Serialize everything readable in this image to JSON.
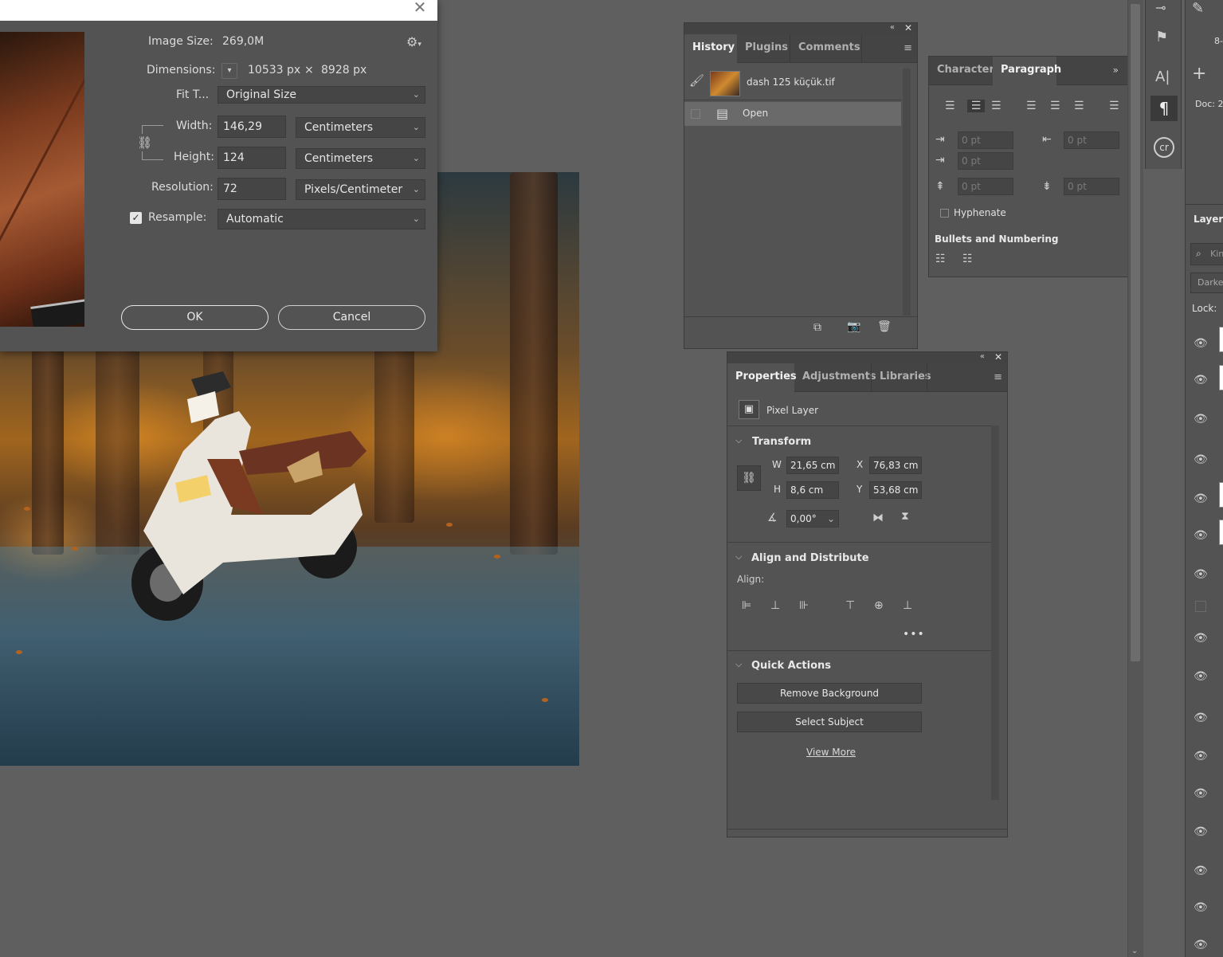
{
  "dialog": {
    "image_size_label": "Image Size:",
    "image_size_value": "269,0M",
    "dimensions_label": "Dimensions:",
    "dimensions_width": "10533 px",
    "dimensions_times": "×",
    "dimensions_height": "8928 px",
    "fit_to_label": "Fit T...",
    "fit_to_value": "Original Size",
    "width_label": "Width:",
    "width_value": "146,29",
    "width_unit": "Centimeters",
    "height_label": "Height:",
    "height_value": "124",
    "height_unit": "Centimeters",
    "resolution_label": "Resolution:",
    "resolution_value": "72",
    "resolution_unit": "Pixels/Centimeter",
    "resample_label": "Resample:",
    "resample_checked": true,
    "resample_value": "Automatic",
    "ok_label": "OK",
    "cancel_label": "Cancel",
    "close_glyph": "✕"
  },
  "history_panel": {
    "tabs": [
      "History",
      "Plugins",
      "Comments"
    ],
    "active_tab": "History",
    "snapshot_name": "dash 125 küçük.tif",
    "items": [
      {
        "label": "Open",
        "selected": true
      }
    ]
  },
  "paragraph_panel": {
    "tabs": [
      "Character",
      "Paragraph"
    ],
    "active_tab": "Paragraph",
    "indent_left": "0 pt",
    "indent_first": "0 pt",
    "indent_right": "0 pt",
    "space_before": "0 pt",
    "space_after": "0 pt",
    "hyphenate_label": "Hyphenate",
    "bullets_heading": "Bullets and Numbering"
  },
  "properties_panel": {
    "tabs": [
      "Properties",
      "Adjustments",
      "Libraries"
    ],
    "active_tab": "Properties",
    "layer_type": "Pixel Layer",
    "transform_heading": "Transform",
    "w_label": "W",
    "w_value": "21,65 cm",
    "h_label": "H",
    "h_value": "8,6 cm",
    "x_label": "X",
    "x_value": "76,83 cm",
    "y_label": "Y",
    "y_value": "53,68 cm",
    "angle_value": "0,00°",
    "align_heading": "Align and Distribute",
    "align_label": "Align:",
    "quick_actions_heading": "Quick Actions",
    "remove_bg_label": "Remove Background",
    "select_subject_label": "Select Subject",
    "view_more_label": "View More"
  },
  "right_edge": {
    "layers_label": "Layers",
    "search_placeholder": "Kin",
    "blend_mode": "Darke",
    "lock_label": "Lock:",
    "doc_label": "Doc: 2",
    "zoom_hint": "8-"
  },
  "colors": {
    "panel_bg": "#535353",
    "workspace_bg": "#5f5f5f",
    "dialog_titlebar": "#ffffff"
  }
}
